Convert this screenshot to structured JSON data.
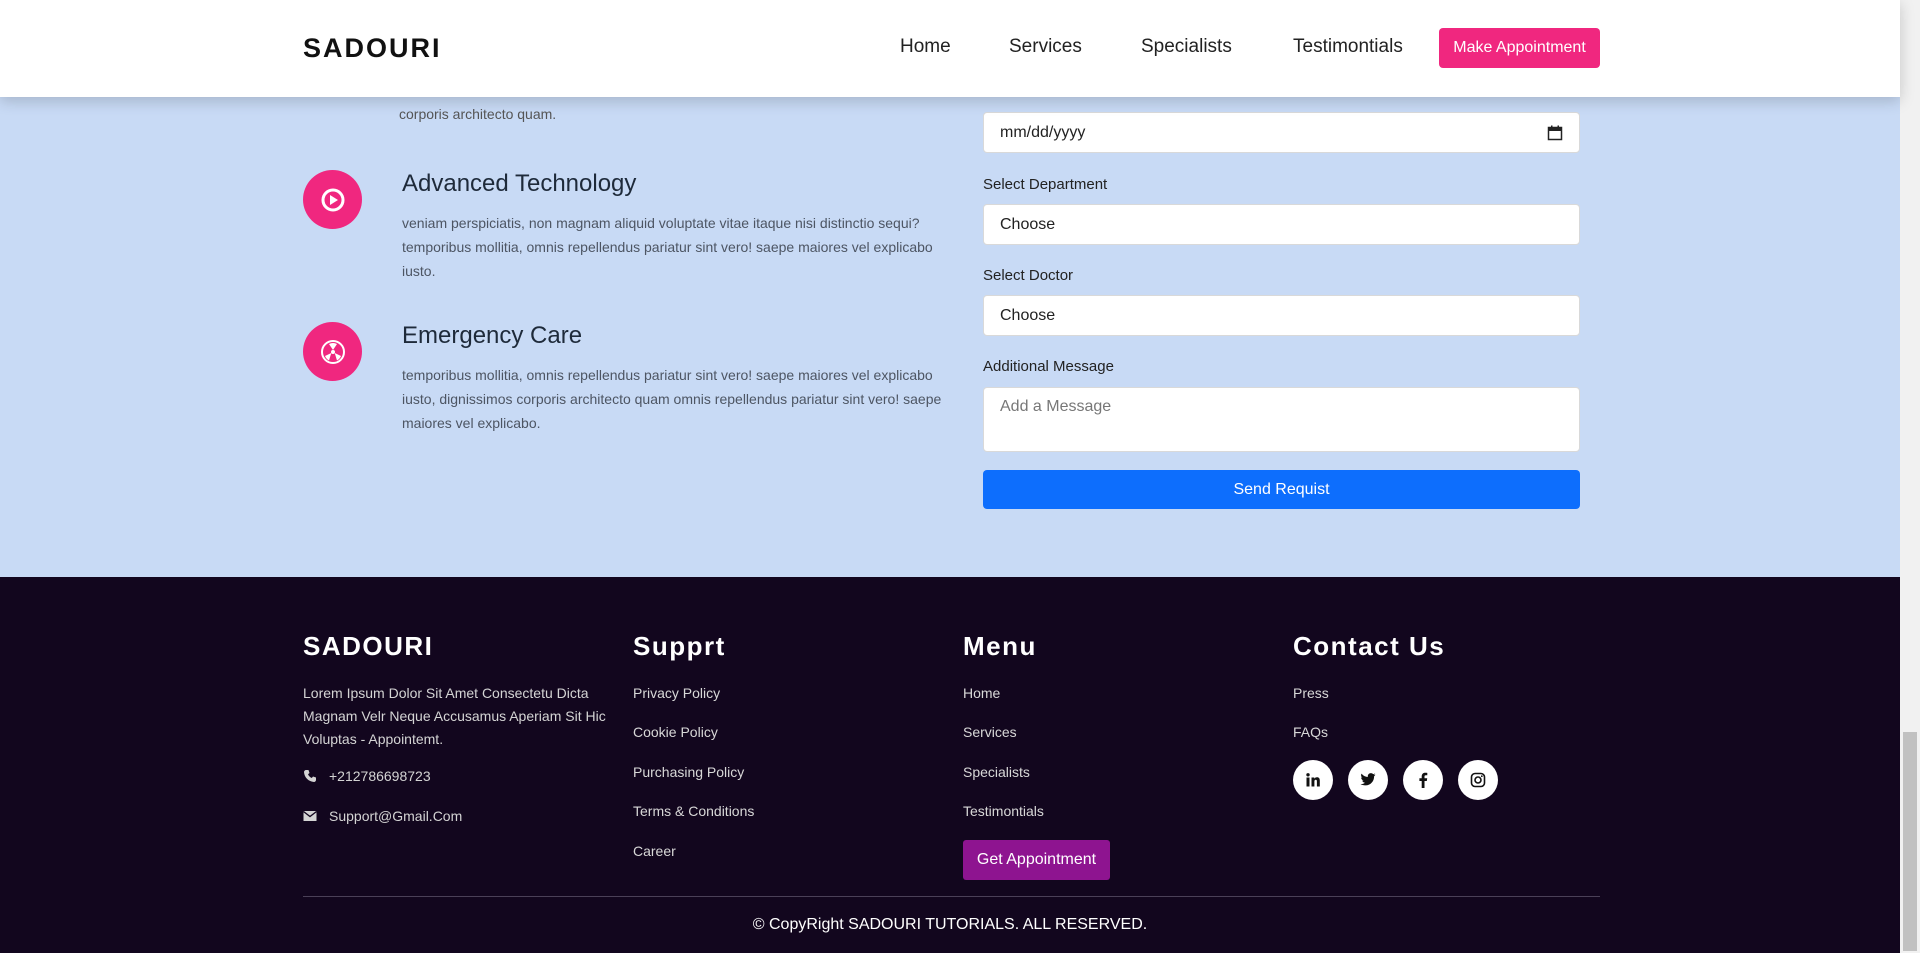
{
  "header": {
    "brand": "SADOURI",
    "nav": [
      "Home",
      "Services",
      "Specialists",
      "Testimontials"
    ],
    "cta": "Make Appointment"
  },
  "features": {
    "partial_text": "corporis architecto quam.",
    "items": [
      {
        "title": "Advanced Technology",
        "text": "veniam perspiciatis, non magnam aliquid voluptate vitae itaque nisi distinctio sequi? temporibus mollitia, omnis repellendus pariatur sint vero! saepe maiores vel explicabo iusto.",
        "icon": "play-circle-icon"
      },
      {
        "title": "Emergency Care",
        "text": "temporibus mollitia, omnis repellendus pariatur sint vero! saepe maiores vel explicabo iusto, dignissimos corporis architecto quam omnis repellendus pariatur sint vero! saepe maiores vel explicabo.",
        "icon": "radiation-icon"
      }
    ]
  },
  "form": {
    "date_value": "mm/dd/yyyy",
    "department_label": "Select Department",
    "department_value": "Choose",
    "doctor_label": "Select Doctor",
    "doctor_value": "Choose",
    "message_label": "Additional Message",
    "message_placeholder": "Add a Message",
    "submit": "Send Requist"
  },
  "footer": {
    "brand": "SADOURI",
    "description": "Lorem Ipsum Dolor Sit Amet Consectetu Dicta Magnam Velr Neque Accusamus Aperiam Sit Hic Voluptas - Appointemt.",
    "phone": "+212786698723",
    "email": "Support@Gmail.Com",
    "support_title": "Supprt",
    "support_links": [
      "Privacy Policy",
      "Cookie Policy",
      "Purchasing Policy",
      "Terms & Conditions",
      "Career"
    ],
    "menu_title": "Menu",
    "menu_links": [
      "Home",
      "Services",
      "Specialists",
      "Testimontials"
    ],
    "menu_cta": "Get Appointment",
    "contact_title": "Contact Us",
    "contact_links": [
      "Press",
      "FAQs"
    ],
    "social": [
      "linkedin-icon",
      "twitter-icon",
      "facebook-icon",
      "instagram-icon"
    ],
    "copyright": "© CopyRight SADOURI TUTORIALS. ALL RESERVED."
  },
  "colors": {
    "accent": "#f0277f",
    "primary_button": "#0d6efd",
    "footer_bg": "#12061e",
    "section_bg": "#c8daf5",
    "get_appointment": "#8e1490"
  }
}
